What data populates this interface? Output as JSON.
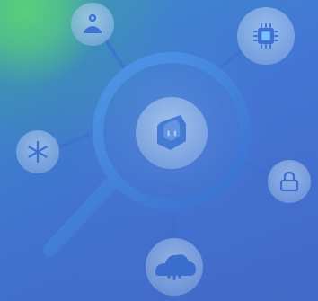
{
  "colors": {
    "accent": "#3f8bdf",
    "accent_light": "#7cc1ff",
    "badge_fill": "#a9c8ee",
    "line": "#3e74d2"
  },
  "icons": {
    "center": "shield-icon",
    "top_left": "user-icon",
    "top_right": "chip-icon",
    "left": "asterisk-icon",
    "right": "lock-icon",
    "bottom": "cloud-icon"
  }
}
